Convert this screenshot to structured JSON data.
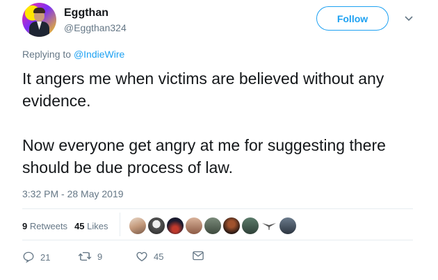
{
  "user": {
    "display_name": "Eggthan",
    "handle": "@Eggthan324"
  },
  "follow_label": "Follow",
  "reply": {
    "prefix": "Replying to ",
    "mention": "@IndieWire"
  },
  "tweet": {
    "paragraph1": "It angers me when victims are believed without any evidence.",
    "paragraph2": "Now everyone get angry at me for suggesting there should be due process of law."
  },
  "timestamp": "3:32 PM - 28 May 2019",
  "stats": {
    "retweets_count": "9",
    "retweets_label": "Retweets",
    "likes_count": "45",
    "likes_label": "Likes"
  },
  "actions": {
    "reply_count": "21",
    "retweet_count": "9",
    "like_count": "45"
  },
  "colors": {
    "accent": "#1da1f2",
    "secondary_text": "#657786"
  }
}
